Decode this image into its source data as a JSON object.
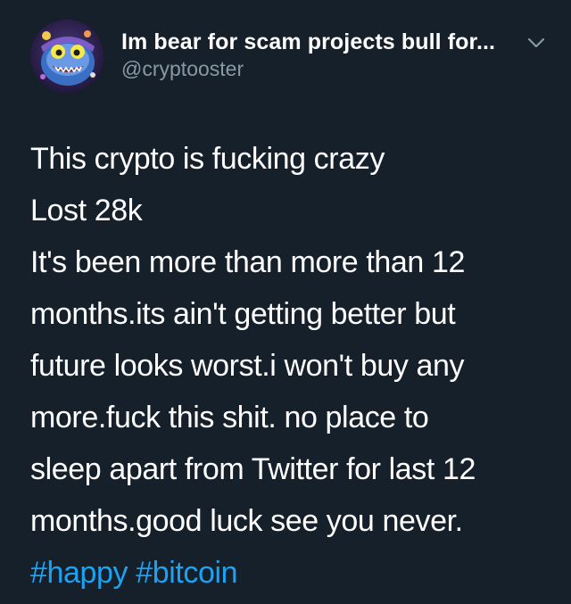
{
  "author": {
    "display_name": "Im bear for scam projects bull for...",
    "handle": "@cryptooster",
    "avatar_icon": "avatar-cartoon-character"
  },
  "actions": {
    "more_icon": "chevron-down-icon"
  },
  "tweet": {
    "lines": [
      "This crypto is fucking crazy",
      "Lost 28k",
      "It's been more than more than 12",
      "months.its ain't getting better but",
      "future looks worst.i won't buy any",
      "more.fuck this shit. no place to",
      "sleep apart from Twitter for last 12",
      "months.good luck see you never."
    ],
    "hashtags": [
      "#happy",
      "#bitcoin"
    ]
  },
  "colors": {
    "background": "#15202b",
    "text": "#ffffff",
    "secondary_text": "#8899a6",
    "hashtag": "#1da1f2"
  }
}
